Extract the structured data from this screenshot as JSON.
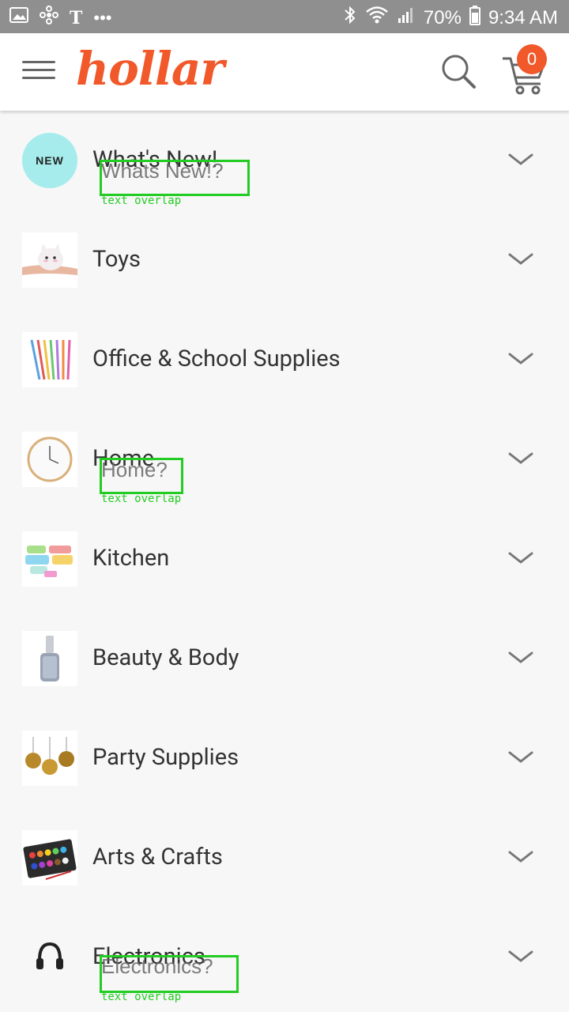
{
  "status_bar": {
    "left_icons": [
      "image-icon",
      "pinwheel-icon",
      "t-icon",
      "more-icon"
    ],
    "battery": "70%",
    "time": "9:34 AM"
  },
  "app_bar": {
    "logo": "hollar",
    "cart_count": "0",
    "brand_color": "#f1582a"
  },
  "categories": [
    {
      "label": "What's New!",
      "thumb": "new-badge"
    },
    {
      "label": "Toys",
      "thumb": "toy-image"
    },
    {
      "label": "Office & School Supplies",
      "thumb": "pens-image"
    },
    {
      "label": "Home",
      "thumb": "clock-image"
    },
    {
      "label": "Kitchen",
      "thumb": "containers-image"
    },
    {
      "label": "Beauty & Body",
      "thumb": "nail-polish-image"
    },
    {
      "label": "Party Supplies",
      "thumb": "pompoms-image"
    },
    {
      "label": "Arts & Crafts",
      "thumb": "paint-palette-image"
    },
    {
      "label": "Electronics",
      "thumb": "headphones-image"
    }
  ],
  "new_badge_text": "NEW",
  "overlays": [
    {
      "text": "Whats New!?",
      "note": "text overlap"
    },
    {
      "text": "Home?",
      "note": "text overlap"
    },
    {
      "text": "Electronics?",
      "note": "text overlap"
    }
  ]
}
